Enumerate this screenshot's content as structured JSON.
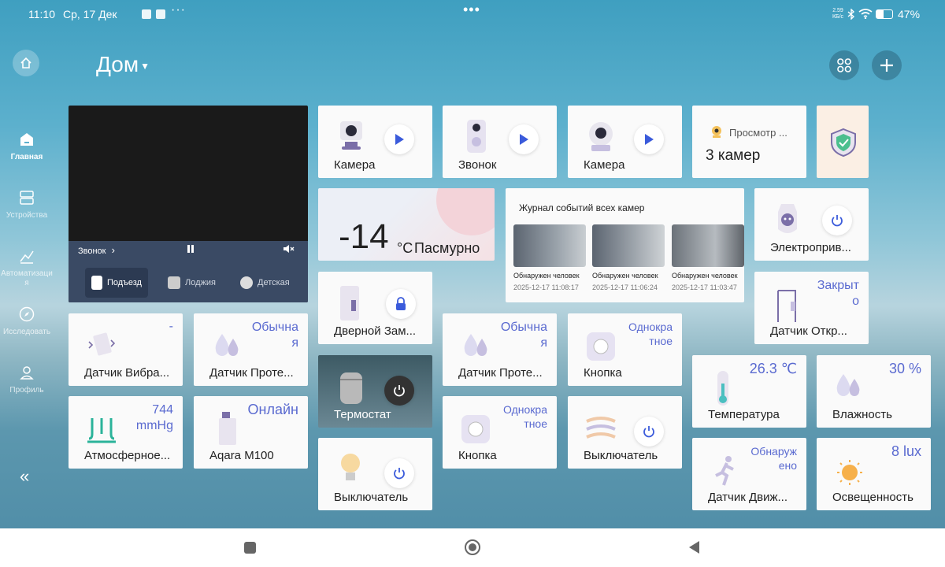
{
  "status": {
    "time": "11:10",
    "date": "Ср, 17 Дек",
    "net_speed": "2.59 КБ/с",
    "battery": "47%"
  },
  "nav": {
    "items": [
      {
        "label": "Главная"
      },
      {
        "label": "Устройства"
      },
      {
        "label": "Автоматизация"
      },
      {
        "label": "Исследовать"
      },
      {
        "label": "Профиль"
      }
    ],
    "collapse": "«"
  },
  "header": {
    "title": "Дом"
  },
  "video": {
    "source": "Звонок",
    "tabs": [
      {
        "label": "Подъезд"
      },
      {
        "label": "Лоджия"
      },
      {
        "label": "Детская"
      }
    ]
  },
  "cards": {
    "cam1": {
      "name": "Камера"
    },
    "cam2": {
      "name": "Звонок"
    },
    "cam3": {
      "name": "Камера"
    },
    "view": {
      "label": "Просмотр ...",
      "count": "3 камер"
    },
    "weather": {
      "temp": "-14",
      "unit": "°C",
      "cond": "Пасмурно"
    },
    "log": {
      "title": "Журнал событий всех камер",
      "events": [
        {
          "label": "Обнаружен человек",
          "time": "2025-12-17 11:08:17"
        },
        {
          "label": "Обнаружен человек",
          "time": "2025-12-17 11:06:24"
        },
        {
          "label": "Обнаружен человек",
          "time": "2025-12-17 11:03:47"
        }
      ]
    },
    "drive": {
      "name": "Электроприв..."
    },
    "lock": {
      "name": "Дверной Зам..."
    },
    "contact": {
      "name": "Датчик Откр...",
      "val1": "Закрыт",
      "val2": "о"
    },
    "vibration": {
      "name": "Датчик Вибра...",
      "val": "-"
    },
    "leak1": {
      "name": "Датчик Проте...",
      "val1": "Обычна",
      "val2": "я"
    },
    "leak2": {
      "name": "Датчик Проте...",
      "val1": "Обычна",
      "val2": "я"
    },
    "button1": {
      "name": "Кнопка",
      "val1": "Однокра",
      "val2": "тное"
    },
    "thermostat": {
      "name": "Термостат"
    },
    "temp": {
      "name": "Температура",
      "val": "26.3 ℃"
    },
    "humidity": {
      "name": "Влажность",
      "val": "30 %"
    },
    "pressure": {
      "name": "Атмосферное...",
      "val1": "744",
      "val2": "mmHg"
    },
    "hub": {
      "name": "Aqara M100",
      "val": "Онлайн"
    },
    "button2": {
      "name": "Кнопка",
      "val1": "Однокра",
      "val2": "тное"
    },
    "switch1": {
      "name": "Выключатель"
    },
    "switch2": {
      "name": "Выключатель"
    },
    "motion": {
      "name": "Датчик Движ...",
      "val1": "Обнаруж",
      "val2": "ено"
    },
    "lux": {
      "name": "Освещенность",
      "val": "8 lux"
    }
  },
  "colors": {
    "accent": "#5a6ad0",
    "play": "#3b5bdb"
  }
}
